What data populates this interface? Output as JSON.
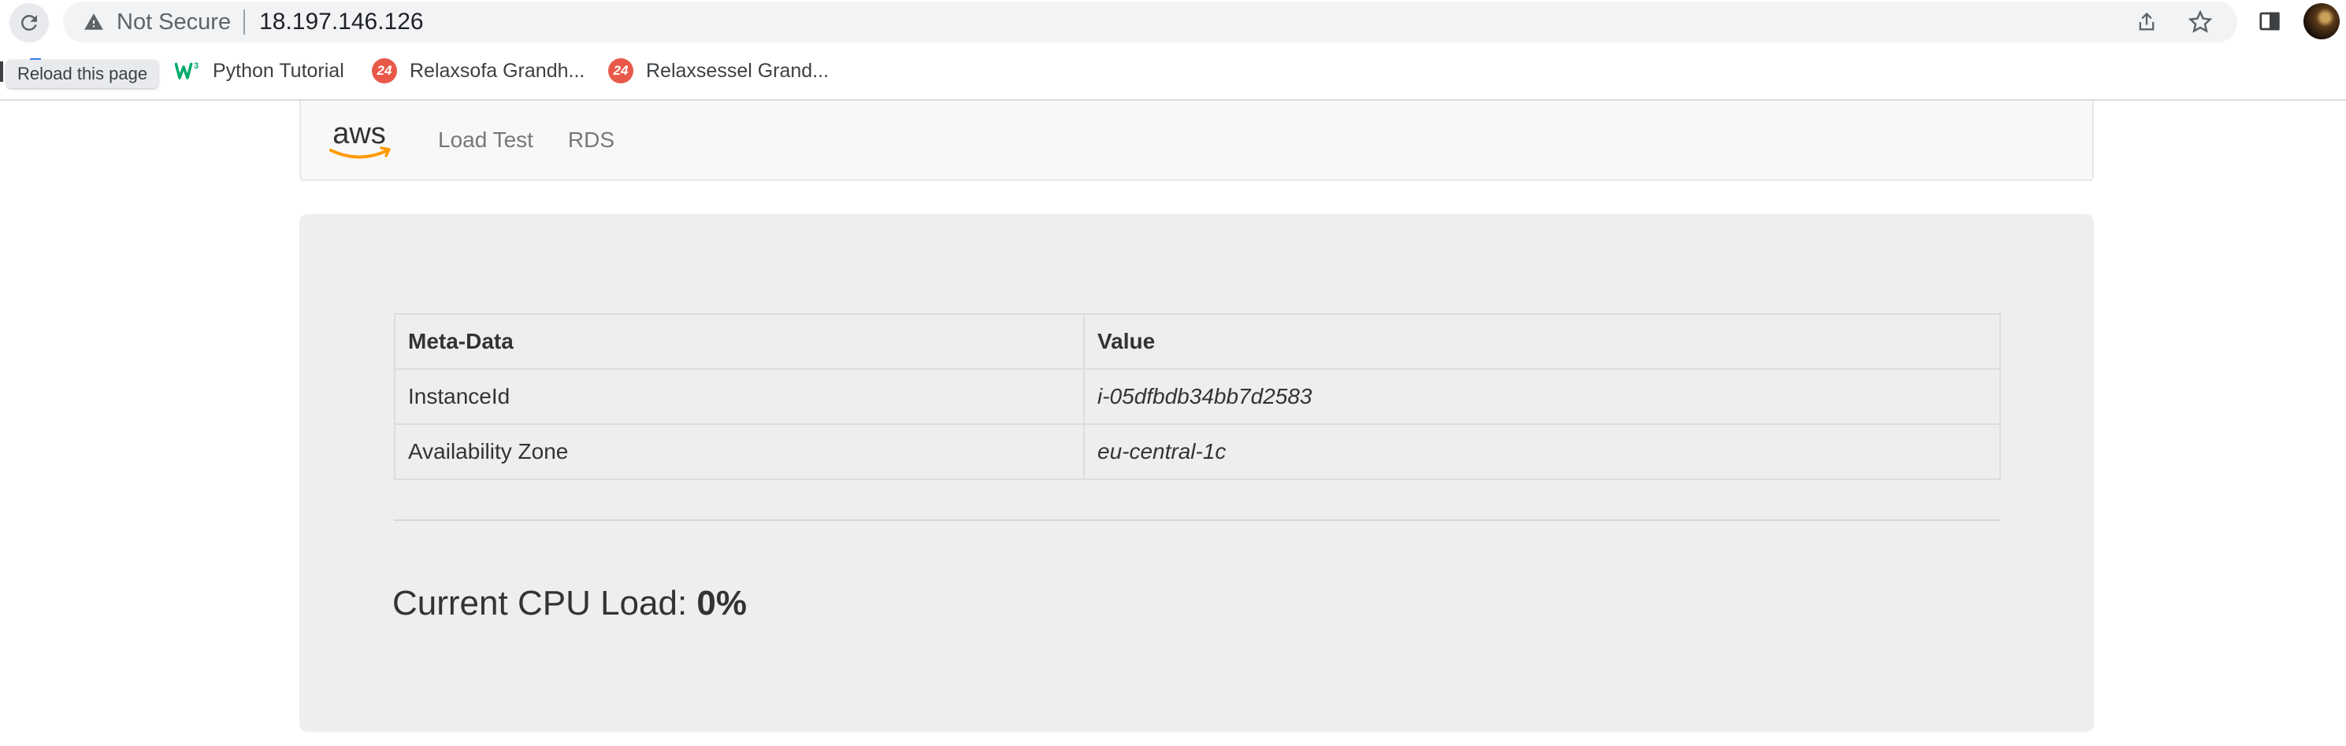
{
  "browser": {
    "security_label": "Not Secure",
    "url": "18.197.146.126",
    "tooltip": "Reload this page",
    "bookmarks": [
      {
        "label": "Python Tutorial",
        "icon": "w3schools-icon"
      },
      {
        "label": "Relaxsofa Grandh...",
        "icon": "24-badge-icon"
      },
      {
        "label": "Relaxsessel Grand...",
        "icon": "24-badge-icon"
      }
    ],
    "badge_text": "24"
  },
  "nav": {
    "logo": "aws",
    "links": [
      "Load Test",
      "RDS"
    ]
  },
  "table": {
    "headers": [
      "Meta-Data",
      "Value"
    ],
    "rows": [
      [
        "InstanceId",
        "i-05dfbdb34bb7d2583"
      ],
      [
        "Availability Zone",
        "eu-central-1c"
      ]
    ]
  },
  "cpu": {
    "label": "Current CPU Load:",
    "value": "0%"
  },
  "colors": {
    "aws_orange": "#ff9900",
    "badge_red": "#e8594a",
    "jumbotron_bg": "#eeeeee"
  }
}
